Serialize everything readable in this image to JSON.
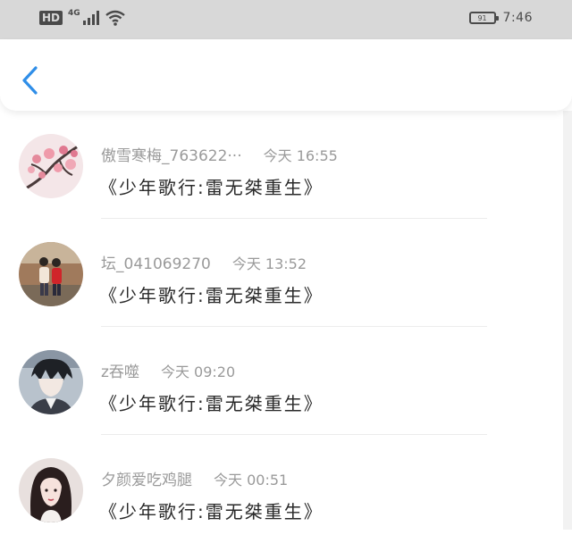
{
  "status_bar": {
    "hd_label": "HD",
    "network_label": "4G",
    "battery_level": "91",
    "time": "7:46"
  },
  "header": {
    "back_icon": "chevron-left-icon",
    "accent_color": "#2f8ee8"
  },
  "comments": [
    {
      "username": "傲雪寒梅_763622···",
      "time": "今天 16:55",
      "title": "《少年歌行:雷无桀重生》",
      "avatar": "plum-blossom"
    },
    {
      "username": "坛_041069270",
      "time": "今天 13:52",
      "title": "《少年歌行:雷无桀重生》",
      "avatar": "couple-photo"
    },
    {
      "username": "z吞噬",
      "time": "今天 09:20",
      "title": "《少年歌行:雷无桀重生》",
      "avatar": "anime-boy"
    },
    {
      "username": "夕颜爱吃鸡腿",
      "time": "今天 00:51",
      "title": "《少年歌行:雷无桀重生》",
      "avatar": "girl-portrait"
    }
  ]
}
